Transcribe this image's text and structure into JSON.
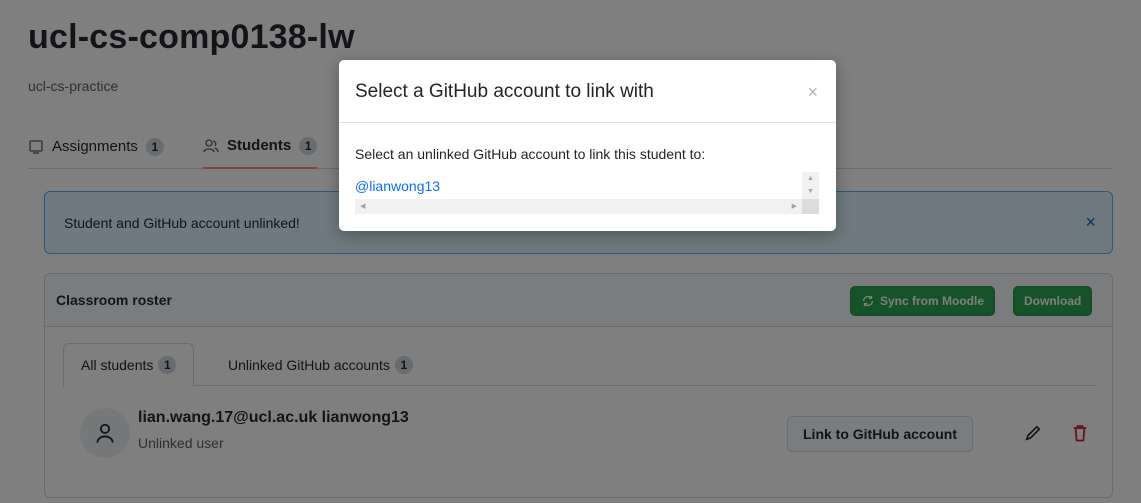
{
  "page": {
    "org_title": "ucl-cs-comp0138-lw",
    "org_subtitle": "ucl-cs-practice"
  },
  "tabs": [
    {
      "label": "Assignments",
      "count": "1",
      "icon": "project-icon"
    },
    {
      "label": "Students",
      "count": "1",
      "icon": "people-icon"
    }
  ],
  "alert": {
    "message": "Student and GitHub account unlinked!",
    "close_label": "×"
  },
  "roster": {
    "title": "Classroom roster",
    "sync_label": "Sync from Moodle",
    "download_label": "Download",
    "subtabs": [
      {
        "label": "All students",
        "count": "1"
      },
      {
        "label": "Unlinked GitHub accounts",
        "count": "1"
      }
    ],
    "student": {
      "name": "lian.wang.17@ucl.ac.uk lianwong13",
      "status": "Unlinked user",
      "link_label": "Link to GitHub account"
    }
  },
  "modal": {
    "title": "Select a GitHub account to link with",
    "close_label": "×",
    "instruction": "Select an unlinked GitHub account to link this student to:",
    "options": [
      "@lianwong13"
    ]
  },
  "colors": {
    "accent_blue": "#0969da",
    "green": "#2da44e",
    "danger": "#cf222e",
    "tab_underline": "#fd8c73"
  }
}
